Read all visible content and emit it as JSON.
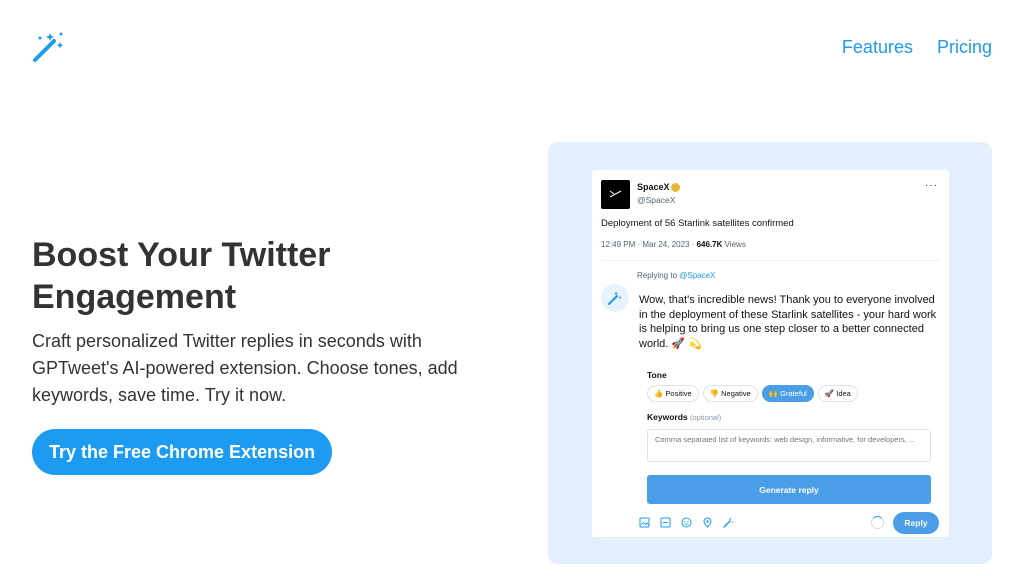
{
  "header": {
    "logo_icon": "magic-wand-icon",
    "nav": [
      {
        "label": "Features"
      },
      {
        "label": "Pricing"
      }
    ]
  },
  "hero": {
    "title": "Boost Your Twitter Engagement",
    "subtitle": "Craft personalized Twitter replies in seconds with GPTweet's AI-powered extension. Choose tones, add keywords, save time. Try it now.",
    "cta_label": "Try the Free Chrome Extension"
  },
  "preview": {
    "tweet": {
      "name": "SpaceX",
      "handle": "@SpaceX",
      "text": "Deployment of 56 Starlink satellites confirmed",
      "time": "12:49 PM · Mar 24, 2023 · ",
      "views_count": "646.7K",
      "views_label": " Views"
    },
    "reply": {
      "replying_prefix": "Replying to ",
      "replying_handle": "@SpaceX",
      "text": "Wow, that's incredible news! Thank you to everyone involved in the deployment of these Starlink satellites - your hard work is helping to bring us one step closer to a better connected world. 🚀 💫"
    },
    "tone_label": "Tone",
    "tones": [
      {
        "label": "👍 Positive"
      },
      {
        "label": "👎 Negative"
      },
      {
        "label": "🙌 Grateful"
      },
      {
        "label": "🚀 Idea"
      }
    ],
    "active_tone": "Grateful",
    "keywords_label": "Keywords",
    "keywords_optional": "(optional)",
    "keywords_placeholder": "Comma separated list of keywords: web design, informative, for developers, ...",
    "generate_label": "Generate reply",
    "reply_button": "Reply",
    "colors": {
      "accent": "#1d9bf0",
      "button": "#4a9ee8",
      "preview_bg": "#e3effc"
    }
  }
}
